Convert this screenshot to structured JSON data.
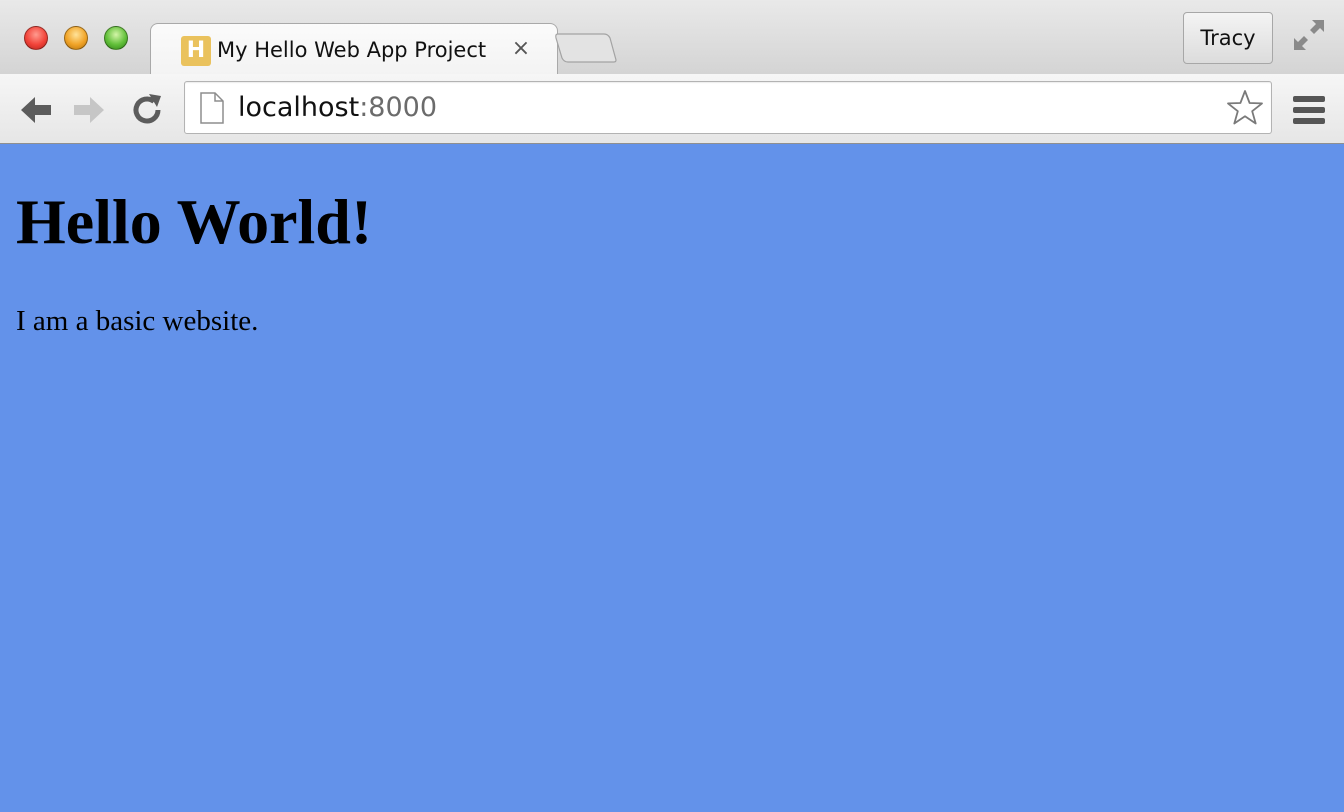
{
  "browser": {
    "tab": {
      "favicon_letter": "H",
      "favicon_color": "#eac25d",
      "title": "My Hello Web App Project",
      "close_glyph": "×"
    },
    "profile_name": "Tracy",
    "address_bar": {
      "host": "localhost",
      "port": ":8000"
    },
    "icons": {
      "back": "back-arrow-icon",
      "forward": "forward-arrow-icon",
      "reload": "reload-icon",
      "page": "page-icon",
      "bookmark": "star-icon",
      "menu": "hamburger-menu-icon",
      "fullscreen": "fullscreen-icon"
    }
  },
  "page": {
    "background_color": "#6392ea",
    "heading": "Hello World!",
    "paragraph": "I am a basic website."
  }
}
